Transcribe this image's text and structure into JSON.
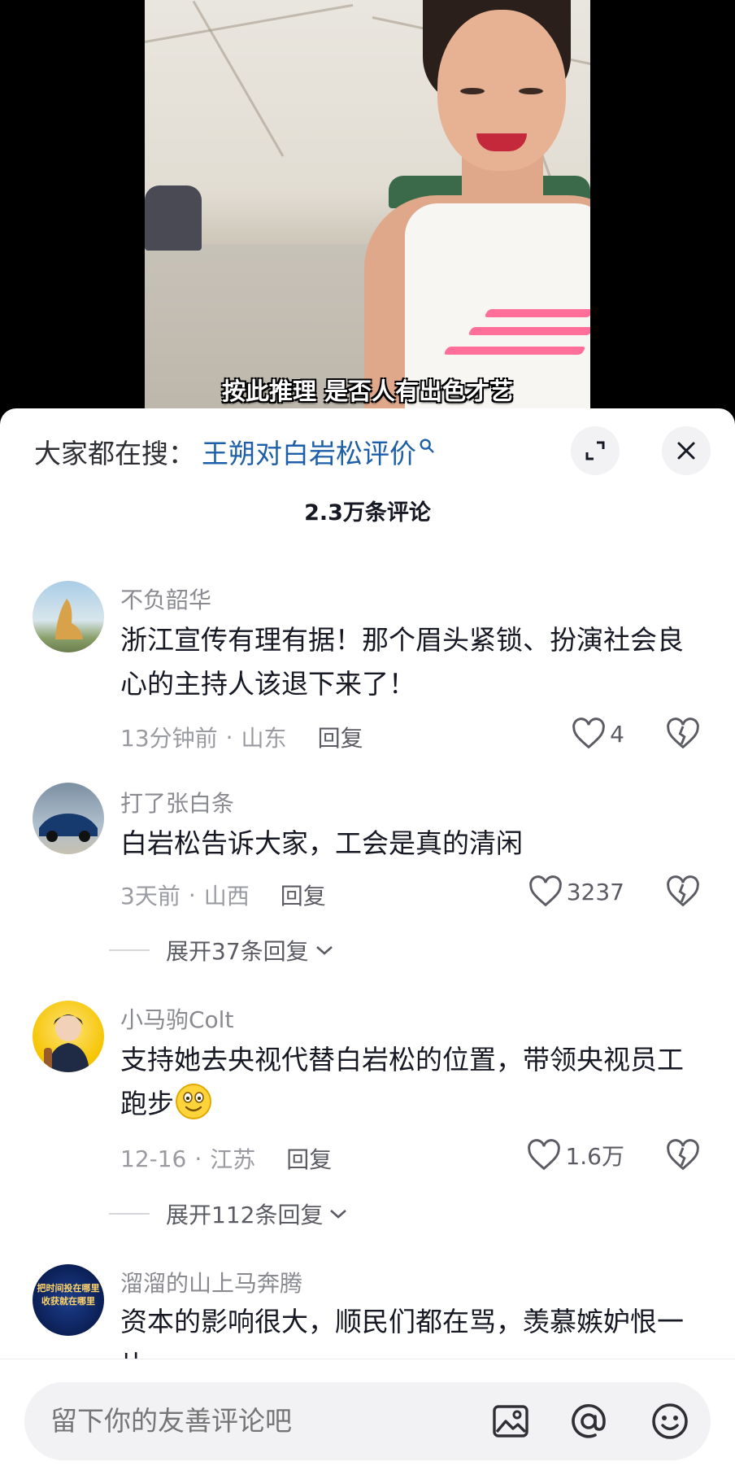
{
  "video": {
    "caption": "按此推理 是否人有出色才艺"
  },
  "header": {
    "search_label": "大家都在搜：",
    "search_query": "王朔对白岩松评价",
    "expand_icon": "expand-icon",
    "close_icon": "close-icon"
  },
  "comment_count": "2.3万条评论",
  "comments": [
    {
      "user": "不负韶华",
      "text": "浙江宣传有理有据！那个眉头紧锁、扮演社会良心的主持人该退下来了！",
      "time": "13分钟前",
      "location": "山东",
      "reply": "回复",
      "likes": "4"
    },
    {
      "user": "打了张白条",
      "text": "白岩松告诉大家，工会是真的清闲",
      "time": "3天前",
      "location": "山西",
      "reply": "回复",
      "likes": "3237",
      "expand": "展开37条回复"
    },
    {
      "user": "小马驹Colt",
      "text": "支持她去央视代替白岩松的位置，带领央视员工跑步",
      "time": "12-16",
      "location": "江苏",
      "reply": "回复",
      "likes": "1.6万",
      "expand": "展开112条回复"
    },
    {
      "user": "溜溜的山上马奔腾",
      "text": "资本的影响很大，顺民们都在骂，羡慕嫉妒恨一片",
      "avatar_text_line1": "把时间投在哪里",
      "avatar_text_line2": "收获就在哪里"
    }
  ],
  "input": {
    "placeholder": "留下你的友善评论吧",
    "icons": [
      "image-icon",
      "at-icon",
      "emoji-icon"
    ]
  },
  "colors": {
    "link": "#1d5fa8",
    "text": "#161823",
    "muted": "#9a9ba1",
    "caption_outline": "#000000"
  }
}
